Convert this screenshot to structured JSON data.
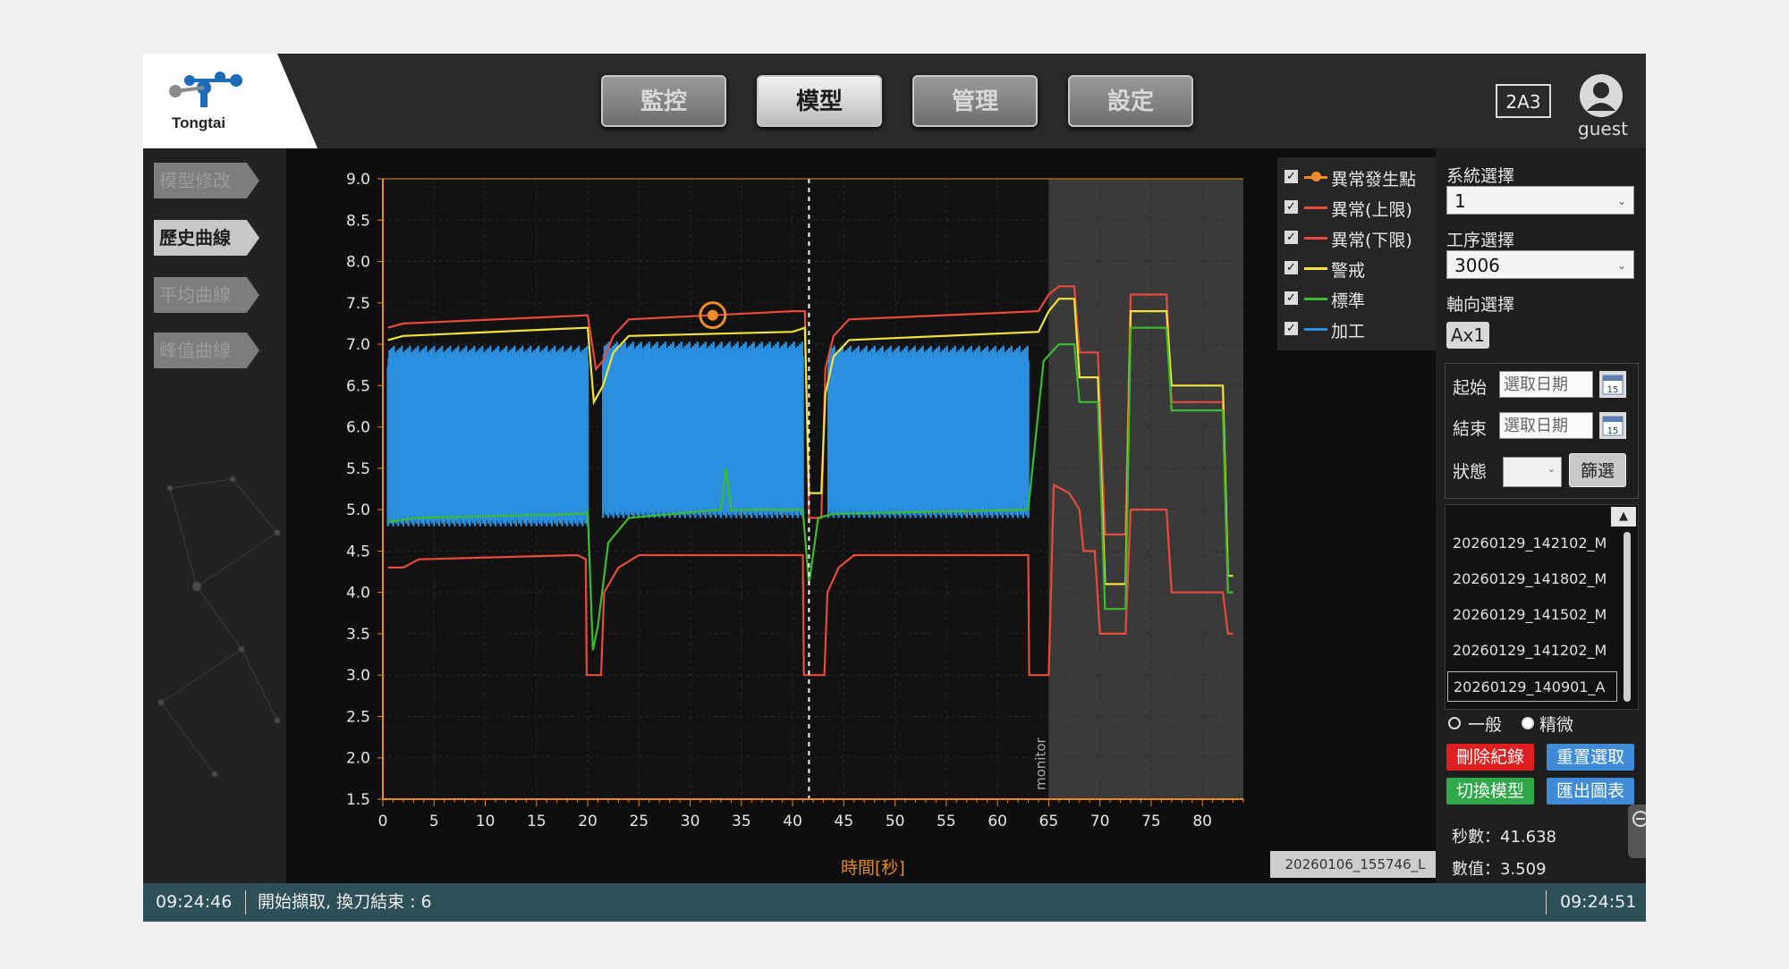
{
  "header": {
    "logo_text": "Tongtai",
    "nav": [
      "監控",
      "模型",
      "管理",
      "設定"
    ],
    "active_nav": 1,
    "machine_id": "2A3",
    "user": "guest"
  },
  "sidebar": {
    "items": [
      "模型修改",
      "歷史曲線",
      "平均曲線",
      "峰值曲線"
    ],
    "active": 1
  },
  "chart_data": {
    "type": "line",
    "xlabel": "時間[秒]",
    "x_range": [
      0,
      84
    ],
    "y_range": [
      1.5,
      9.0
    ],
    "x_ticks": [
      0,
      5,
      10,
      15,
      20,
      25,
      30,
      35,
      40,
      45,
      50,
      55,
      60,
      65,
      70,
      75,
      80
    ],
    "y_ticks": [
      1.5,
      2.0,
      2.5,
      3.0,
      3.5,
      4.0,
      4.5,
      5.0,
      5.5,
      6.0,
      6.5,
      7.0,
      7.5,
      8.0,
      8.5,
      9.0
    ],
    "monitor_region": {
      "label": "monitor",
      "start": 65
    },
    "cursor_x": 41.6,
    "anomaly_point": {
      "x": 32.2,
      "y": 7.35
    },
    "legend": [
      {
        "name": "異常發生點",
        "color": "#f08a2a",
        "marker": true
      },
      {
        "name": "異常(上限)",
        "color": "#e84a3c"
      },
      {
        "name": "異常(下限)",
        "color": "#e84a3c"
      },
      {
        "name": "警戒",
        "color": "#f2e23a"
      },
      {
        "name": "標準",
        "color": "#3dbb2e"
      },
      {
        "name": "加工",
        "color": "#2b8fe0"
      }
    ],
    "series": [
      {
        "name": "異常(上限)",
        "color": "#e84a3c",
        "points": [
          [
            0.5,
            7.2
          ],
          [
            2,
            7.25
          ],
          [
            20,
            7.35
          ],
          [
            20.8,
            6.7
          ],
          [
            21.5,
            6.8
          ],
          [
            22.5,
            7.1
          ],
          [
            24,
            7.3
          ],
          [
            40,
            7.4
          ],
          [
            41.2,
            7.4
          ],
          [
            41.6,
            4.9
          ],
          [
            42.8,
            4.9
          ],
          [
            43.2,
            6.7
          ],
          [
            44,
            7.1
          ],
          [
            45.5,
            7.3
          ],
          [
            64,
            7.4
          ],
          [
            65,
            7.6
          ],
          [
            66,
            7.7
          ],
          [
            67.5,
            7.7
          ],
          [
            68,
            6.9
          ],
          [
            69.8,
            6.9
          ],
          [
            70.5,
            4.7
          ],
          [
            72.5,
            4.7
          ],
          [
            73,
            7.6
          ],
          [
            76.5,
            7.6
          ],
          [
            77,
            6.3
          ],
          [
            82,
            6.3
          ],
          [
            82.5,
            4.0
          ],
          [
            83,
            4.0
          ]
        ]
      },
      {
        "name": "異常(下限)",
        "color": "#e84a3c",
        "points": [
          [
            0.5,
            4.3
          ],
          [
            2,
            4.3
          ],
          [
            3.5,
            4.4
          ],
          [
            19,
            4.45
          ],
          [
            19.8,
            4.4
          ],
          [
            19.9,
            3.0
          ],
          [
            21.3,
            3.0
          ],
          [
            21.6,
            4.0
          ],
          [
            23,
            4.3
          ],
          [
            25,
            4.45
          ],
          [
            41,
            4.45
          ],
          [
            41.1,
            3.0
          ],
          [
            43.1,
            3.0
          ],
          [
            43.4,
            4.0
          ],
          [
            44.5,
            4.3
          ],
          [
            46,
            4.45
          ],
          [
            63,
            4.45
          ],
          [
            63.1,
            3.0
          ],
          [
            65,
            3.0
          ],
          [
            65.5,
            5.3
          ],
          [
            67,
            5.2
          ],
          [
            68,
            5.0
          ],
          [
            68.4,
            4.5
          ],
          [
            69.5,
            4.5
          ],
          [
            70,
            3.5
          ],
          [
            72.5,
            3.5
          ],
          [
            73,
            5.0
          ],
          [
            76.5,
            5.0
          ],
          [
            77,
            4.0
          ],
          [
            82,
            4.0
          ],
          [
            82.5,
            3.5
          ],
          [
            83,
            3.5
          ]
        ]
      },
      {
        "name": "警戒",
        "color": "#f2e23a",
        "points": [
          [
            0.5,
            7.05
          ],
          [
            2,
            7.1
          ],
          [
            20,
            7.2
          ],
          [
            20.6,
            6.3
          ],
          [
            21.5,
            6.5
          ],
          [
            22.5,
            6.9
          ],
          [
            24,
            7.1
          ],
          [
            40,
            7.15
          ],
          [
            41.2,
            7.2
          ],
          [
            41.6,
            5.2
          ],
          [
            42.8,
            5.2
          ],
          [
            43.2,
            6.4
          ],
          [
            44,
            6.85
          ],
          [
            45.5,
            7.05
          ],
          [
            64,
            7.15
          ],
          [
            65,
            7.4
          ],
          [
            66,
            7.55
          ],
          [
            67.5,
            7.55
          ],
          [
            68,
            6.6
          ],
          [
            69.8,
            6.6
          ],
          [
            70.5,
            4.1
          ],
          [
            72.5,
            4.1
          ],
          [
            73,
            7.4
          ],
          [
            76.5,
            7.4
          ],
          [
            77,
            6.5
          ],
          [
            82,
            6.5
          ],
          [
            82.5,
            4.2
          ],
          [
            83,
            4.2
          ]
        ]
      },
      {
        "name": "標準",
        "color": "#3dbb2e",
        "points": [
          [
            0.5,
            4.85
          ],
          [
            3,
            4.9
          ],
          [
            19.8,
            4.95
          ],
          [
            20,
            5.0
          ],
          [
            20.5,
            3.3
          ],
          [
            21,
            3.6
          ],
          [
            22,
            4.6
          ],
          [
            24,
            4.9
          ],
          [
            33,
            5.0
          ],
          [
            33.5,
            5.5
          ],
          [
            34,
            5.0
          ],
          [
            41,
            5.0
          ],
          [
            41.6,
            4.1
          ],
          [
            42.5,
            4.9
          ],
          [
            44,
            4.95
          ],
          [
            63,
            5.0
          ],
          [
            64.5,
            6.8
          ],
          [
            66,
            7.0
          ],
          [
            67.5,
            7.0
          ],
          [
            68,
            6.3
          ],
          [
            69.8,
            6.3
          ],
          [
            70.5,
            3.8
          ],
          [
            72.5,
            3.8
          ],
          [
            73,
            7.2
          ],
          [
            76.5,
            7.2
          ],
          [
            77,
            6.2
          ],
          [
            82,
            6.2
          ],
          [
            82.5,
            4.0
          ],
          [
            83,
            4.0
          ]
        ]
      }
    ],
    "processing": {
      "name": "加工",
      "color": "#2b8fe0",
      "segments": [
        {
          "start": 0.5,
          "end": 20.0,
          "low": 4.85,
          "high": 6.85
        },
        {
          "start": 21.5,
          "end": 41.0,
          "low": 4.95,
          "high": 6.9
        },
        {
          "start": 43.5,
          "end": 63.0,
          "low": 4.95,
          "high": 6.85
        }
      ]
    }
  },
  "file_tag": "20260106_155746_L",
  "right_panel": {
    "system_label": "系統選擇",
    "system_value": "1",
    "process_label": "工序選擇",
    "process_value": "3006",
    "axis_label": "軸向選擇",
    "axis_value": "Ax1",
    "start_label": "起始",
    "end_label": "結束",
    "date_placeholder": "選取日期",
    "calendar_day": "15",
    "status_label": "狀態",
    "filter_button": "篩選",
    "records": [
      "20260129_142102_M",
      "20260129_141802_M",
      "20260129_141502_M",
      "20260129_141202_M",
      "20260129_140901_A"
    ],
    "selected_record": 4,
    "radio_normal": "一般",
    "radio_fine": "精微",
    "delete_button": "刪除紀錄",
    "reset_button": "重置選取",
    "switch_button": "切換模型",
    "export_button": "匯出圖表",
    "seconds_label": "秒數：",
    "seconds_value": "41.638",
    "value_label": "數值：",
    "value_value": "3.509"
  },
  "statusbar": {
    "time_left": "09:24:46",
    "message": "開始擷取, 換刀結束 : 6",
    "time_right": "09:24:51"
  }
}
